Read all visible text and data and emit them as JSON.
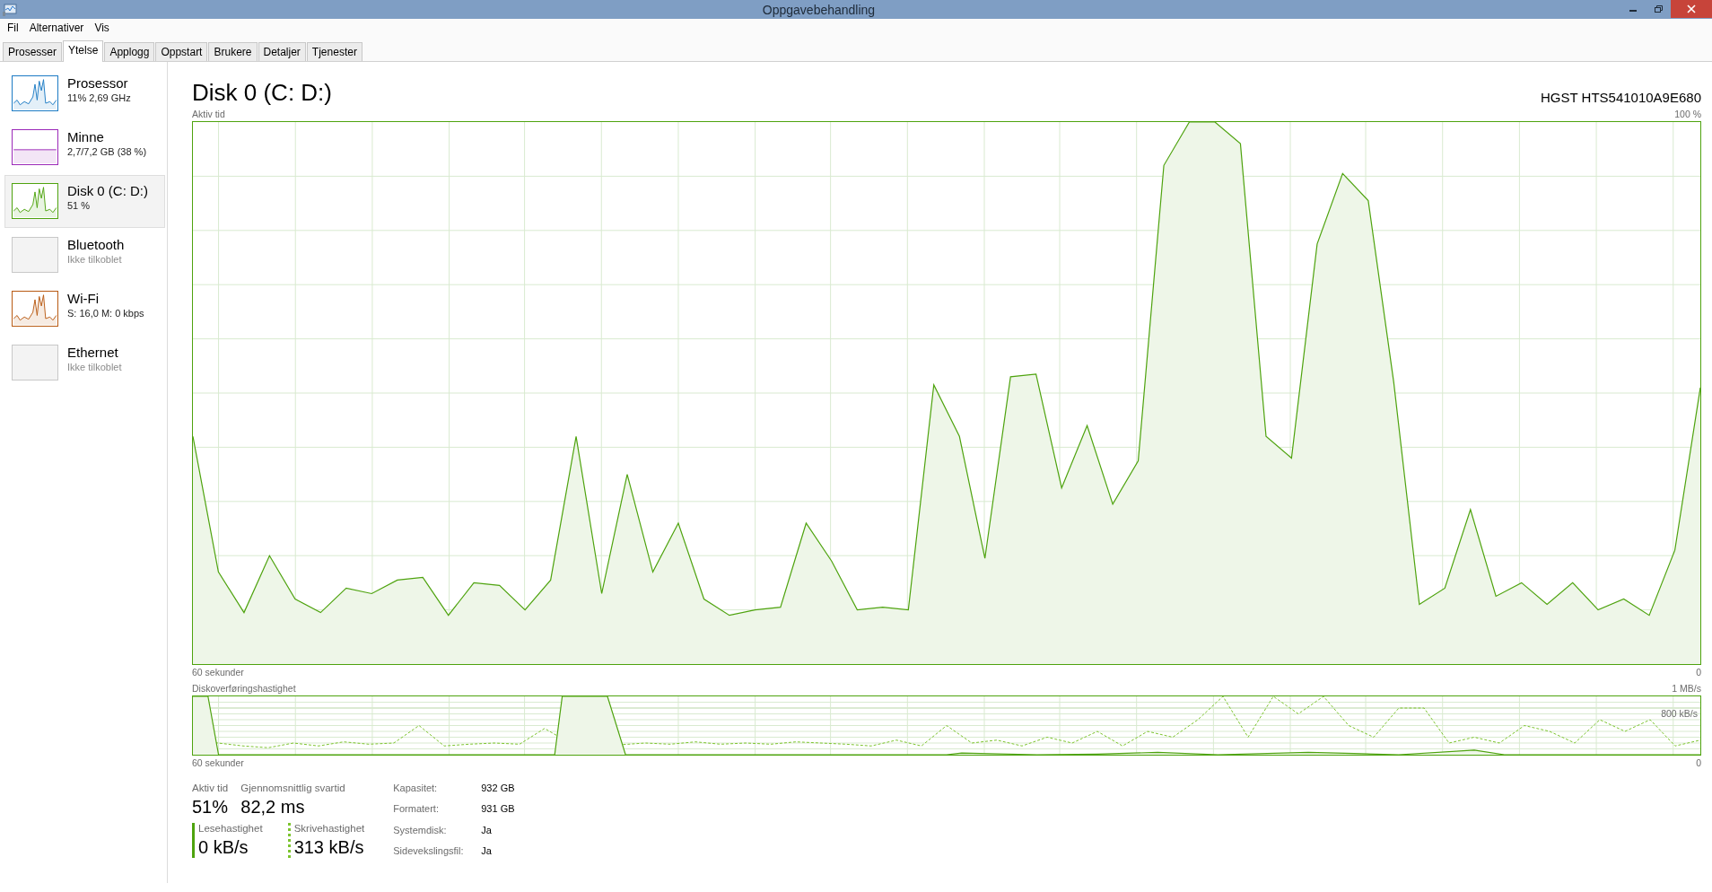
{
  "window": {
    "title": "Oppgavebehandling"
  },
  "menu": [
    "Fil",
    "Alternativer",
    "Vis"
  ],
  "tabs": [
    {
      "label": "Prosesser",
      "selected": false
    },
    {
      "label": "Ytelse",
      "selected": true
    },
    {
      "label": "Applogg",
      "selected": false
    },
    {
      "label": "Oppstart",
      "selected": false
    },
    {
      "label": "Brukere",
      "selected": false
    },
    {
      "label": "Detaljer",
      "selected": false
    },
    {
      "label": "Tjenester",
      "selected": false
    }
  ],
  "sidebar": {
    "items": [
      {
        "name": "Prosessor",
        "detail": "11% 2,69 GHz",
        "kind": "graph",
        "color": "#1c7bc4",
        "selected": false
      },
      {
        "name": "Minne",
        "detail": "2,7/7,2 GB (38 %)",
        "kind": "flat",
        "color": "#9b28b8",
        "selected": false
      },
      {
        "name": "Disk 0 (C: D:)",
        "detail": "51 %",
        "kind": "graph",
        "color": "#4ea30e",
        "selected": true
      },
      {
        "name": "Bluetooth",
        "detail": "Ikke tilkoblet",
        "kind": "empty",
        "selected": false
      },
      {
        "name": "Wi-Fi",
        "detail": "S: 16,0 M: 0 kbps",
        "kind": "graph",
        "color": "#b85a12",
        "selected": false
      },
      {
        "name": "Ethernet",
        "detail": "Ikke tilkoblet",
        "kind": "empty",
        "selected": false
      }
    ]
  },
  "detail": {
    "title": "Disk 0 (C: D:)",
    "model": "HGST HTS541010A9E680",
    "active_chart": {
      "label": "Aktiv tid",
      "max": "100 %",
      "x_start": "60 sekunder",
      "x_end": "0"
    },
    "transfer_chart": {
      "label": "Diskoverføringshastighet",
      "max": "1 MB/s",
      "inner": "800 kB/s",
      "x_start": "60 sekunder",
      "x_end": "0"
    },
    "stats": [
      {
        "label": "Aktiv tid",
        "value": "51%"
      },
      {
        "label": "Gjennomsnittlig svartid",
        "value": "82,2 ms"
      }
    ],
    "rates": [
      {
        "label": "Lesehastighet",
        "value": "0 kB/s",
        "kind": "solid"
      },
      {
        "label": "Skrivehastighet",
        "value": "313 kB/s",
        "kind": "dotted"
      }
    ],
    "properties": [
      {
        "label": "Kapasitet:",
        "value": "932 GB"
      },
      {
        "label": "Formatert:",
        "value": "931 GB"
      },
      {
        "label": "Systemdisk:",
        "value": "Ja"
      },
      {
        "label": "Sidevekslingsfil:",
        "value": "Ja"
      }
    ]
  }
}
